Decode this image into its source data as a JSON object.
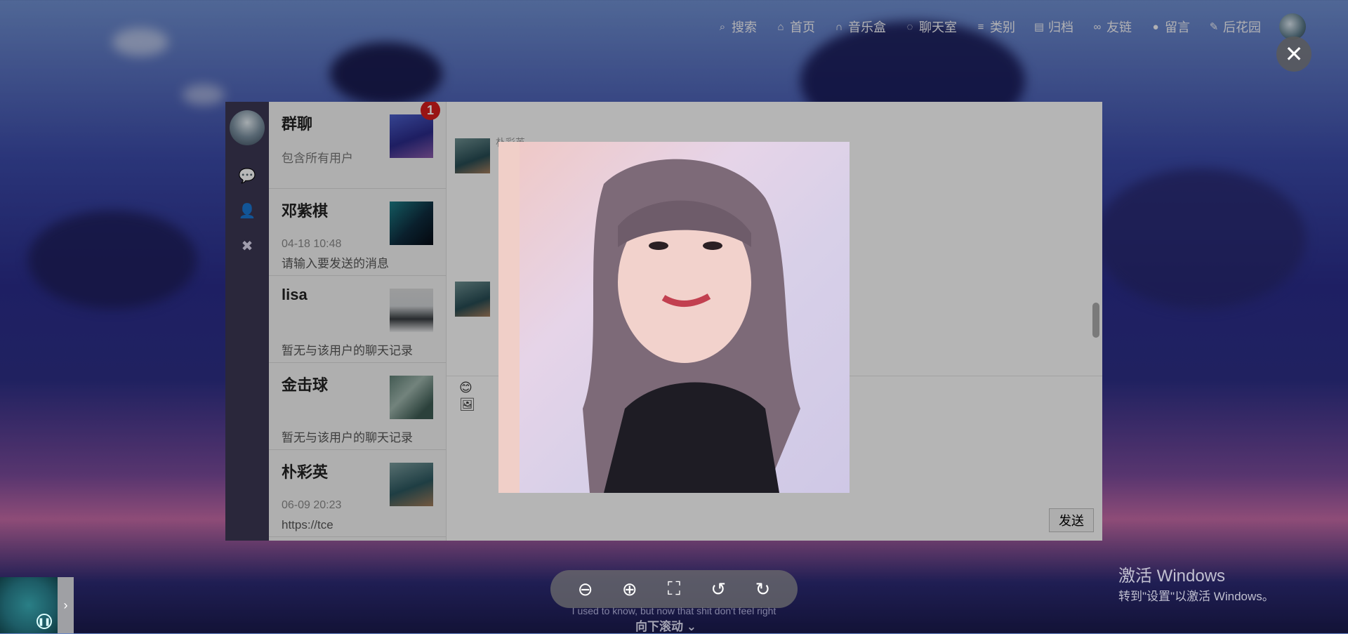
{
  "nav": {
    "items": [
      {
        "icon": "search-icon",
        "glyph": "⌕",
        "label": "搜索"
      },
      {
        "icon": "home-icon",
        "glyph": "⌂",
        "label": "首页"
      },
      {
        "icon": "headphones-icon",
        "glyph": "∩",
        "label": "音乐盒"
      },
      {
        "icon": "chat-bubble-icon",
        "glyph": "◌",
        "label": "聊天室"
      },
      {
        "icon": "sliders-icon",
        "glyph": "≡",
        "label": "类别"
      },
      {
        "icon": "book-icon",
        "glyph": "▤",
        "label": "归档"
      },
      {
        "icon": "link-icon",
        "glyph": "∞",
        "label": "友链"
      },
      {
        "icon": "comment-icon",
        "glyph": "●",
        "label": "留言"
      },
      {
        "icon": "leaf-icon",
        "glyph": "✎",
        "label": "后花园"
      }
    ]
  },
  "rail": {
    "icons": [
      {
        "name": "chat-icon",
        "glyph": "💬"
      },
      {
        "name": "add-user-icon",
        "glyph": "👤"
      },
      {
        "name": "close-icon",
        "glyph": "✖"
      }
    ]
  },
  "conversations": [
    {
      "name": "群聊",
      "time": "",
      "sub": "包含所有用户",
      "badge": "1",
      "thumb": "linear-gradient(160deg,#4a5ec8,#2a2a88 55%,#8a5aa8)"
    },
    {
      "name": "邓紫棋",
      "time": "04-18 10:48",
      "sub": "请输入要发送的消息",
      "badge": "",
      "thumb": "linear-gradient(135deg,#1c7d86,#0e2c3e 55%,#070b14)"
    },
    {
      "name": "lisa",
      "time": "",
      "sub": "暂无与该用户的聊天记录",
      "badge": "",
      "thumb": "linear-gradient(180deg,#d8d8d8,#cfd3d6 40%,#383c40 70%,#e9eaeb)"
    },
    {
      "name": "金击球",
      "time": "",
      "sub": "暂无与该用户的聊天记录",
      "badge": "",
      "thumb": "linear-gradient(135deg,#5e7e74,#9fb6ad 40%,#3c5a52 80%)"
    },
    {
      "name": "朴彩英",
      "time": "06-09 20:23",
      "sub": "https://tce",
      "badge": "",
      "thumb": "linear-gradient(160deg,#7a9b9c,#2b565e 55%,#a07a58)"
    }
  ],
  "chat": {
    "sender_label": "朴彩英",
    "emoji_icon": "😊",
    "image_icon": "🖼",
    "send_label": "发送"
  },
  "viewer": {
    "close_glyph": "✕",
    "tools": [
      {
        "name": "zoom-out-icon",
        "glyph": "⊖"
      },
      {
        "name": "zoom-in-icon",
        "glyph": "⊕"
      },
      {
        "name": "fullscreen-icon",
        "glyph": "⛶"
      },
      {
        "name": "rotate-left-icon",
        "glyph": "↺"
      },
      {
        "name": "rotate-right-icon",
        "glyph": "↻"
      }
    ]
  },
  "footer": {
    "lyrics_line": "I used to know, but now that shit don't feel right",
    "scroll_hint": "向下滚动 ⌄",
    "watermark_title": "激活 Windows",
    "watermark_sub": "转到\"设置\"以激活 Windows。"
  }
}
